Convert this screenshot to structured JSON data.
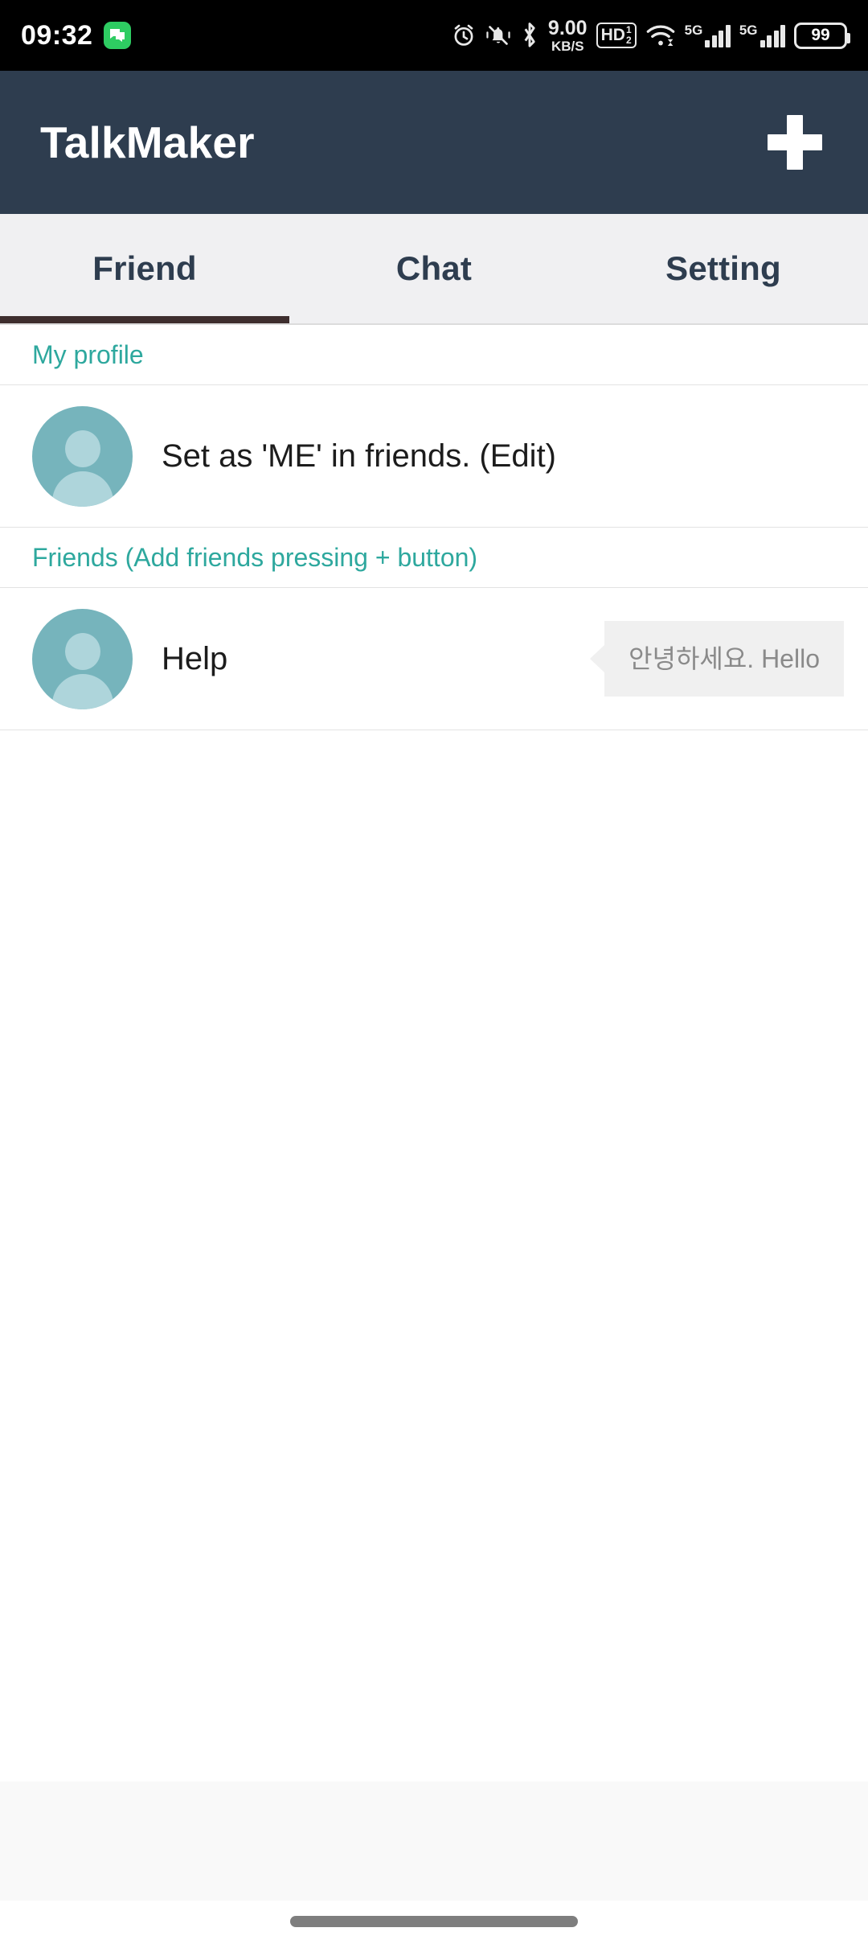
{
  "status_bar": {
    "time": "09:32",
    "message_icon": "message-icon",
    "alarm_icon": "alarm-clock-icon",
    "mute_icon": "bell-mute-icon",
    "bluetooth_icon": "bluetooth-icon",
    "network_speed_value": "9.00",
    "network_speed_unit": "KB/S",
    "hd_label": "HD",
    "hd_num": "1",
    "hd_den": "2",
    "wifi_icon": "wifi-icon",
    "sim1_label": "5G",
    "sim2_label": "5G",
    "battery_level": "99"
  },
  "app_bar": {
    "title": "TalkMaker",
    "add_button_icon": "plus-icon"
  },
  "tabs": [
    {
      "label": "Friend",
      "active": true
    },
    {
      "label": "Chat",
      "active": false
    },
    {
      "label": "Setting",
      "active": false
    }
  ],
  "sections": [
    {
      "header": "My profile",
      "rows": [
        {
          "name": "Set as 'ME' in friends. (Edit)",
          "bubble": ""
        }
      ]
    },
    {
      "header": "Friends (Add friends pressing + button)",
      "rows": [
        {
          "name": "Help",
          "bubble": "안녕하세요. Hello"
        }
      ]
    }
  ],
  "colors": {
    "app_bar": "#2E3D4F",
    "tab_bar": "#F0F0F2",
    "tab_indicator": "#3E2E2E",
    "accent_teal": "#2EA89E",
    "avatar_bg": "#76B4BC",
    "avatar_fg": "#AED5DB",
    "bubble_bg": "#F0F0F0",
    "bubble_text": "#8A8A8A",
    "status_bar_bg": "#000000",
    "bottom_band": "#F9F9F9",
    "nav_pill": "#7E7E7E"
  }
}
